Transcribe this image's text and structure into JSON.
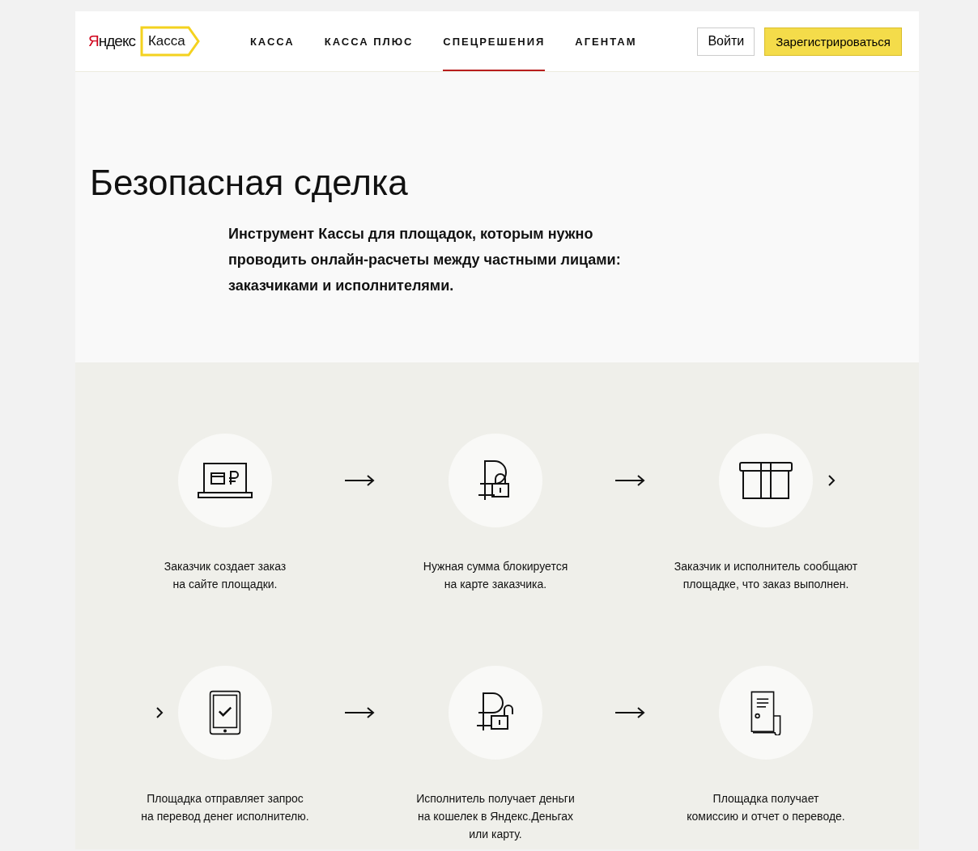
{
  "header": {
    "logo": {
      "brand": "Яндекс",
      "product": "Касса"
    },
    "nav": [
      {
        "label": "КАССА",
        "selected": false
      },
      {
        "label": "КАССА ПЛЮС",
        "selected": false
      },
      {
        "label": "СПЕЦРЕШЕНИЯ",
        "selected": true
      },
      {
        "label": "АГЕНТАМ",
        "selected": false
      }
    ],
    "login_button": "Войти",
    "register_button": "Зарегистрироваться"
  },
  "hero": {
    "title": "Безопасная сделка",
    "description": "Инструмент Кассы для площадок, которым нужно проводить онлайн-расчеты между частными лицами: заказчиками и исполнителями."
  },
  "steps": [
    [
      {
        "kind": "laptop",
        "text": "Заказчик создает заказ\nна сайте площадки."
      },
      {
        "kind": "ruble-lock",
        "text": "Нужная сумма блокируется\nна карте заказчика."
      },
      {
        "kind": "box",
        "text": "Заказчик и исполнитель сообщают\nплощадке, что заказ выполнен."
      }
    ],
    [
      {
        "kind": "tablet",
        "text": "Площадка отправляет запрос\nна перевод денег исполнителю."
      },
      {
        "kind": "ruble-unlock",
        "text": "Исполнитель получает деньги\nна кошелек в Яндекс.Деньгах\nили карту."
      },
      {
        "kind": "document",
        "text": "Площадка получает\nкомиссию и отчет о переводе."
      }
    ]
  ]
}
